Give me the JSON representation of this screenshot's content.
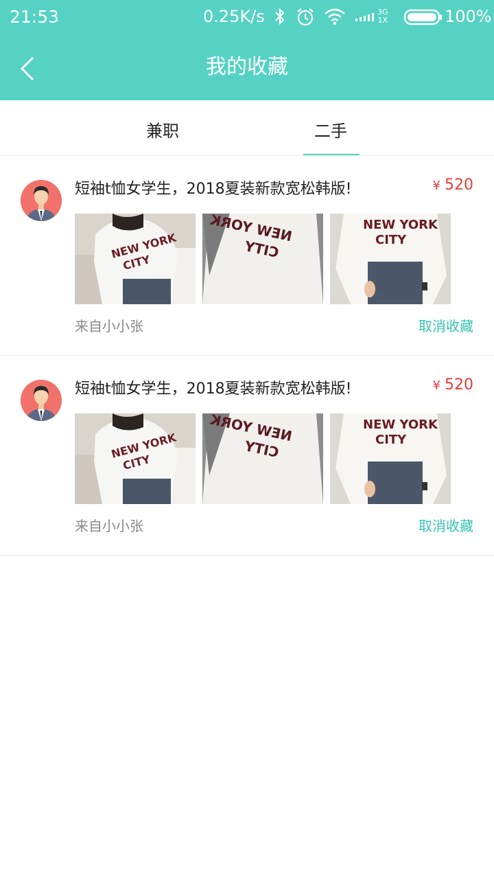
{
  "status_bar": {
    "time": "21:53",
    "speed": "0.25K/s",
    "network_top": "3G",
    "network_bottom": "1X",
    "battery_percent": "100%",
    "icons": [
      "bluetooth-icon",
      "alarm-icon",
      "wifi-icon",
      "signal-icon",
      "battery-icon"
    ]
  },
  "header": {
    "title": "我的收藏",
    "back_icon": "chevron-left-icon",
    "background_color": "#55d2c3"
  },
  "tabs": [
    {
      "label": "兼职",
      "active": false
    },
    {
      "label": "二手",
      "active": true
    }
  ],
  "items": [
    {
      "title": "短袖t恤女学生，2018夏装新款宽松韩版!",
      "currency": "¥",
      "price": "520",
      "from": "来自小小张",
      "cancel_label": "取消收藏",
      "image_text": [
        "NEW YORK",
        "CITY"
      ]
    },
    {
      "title": "短袖t恤女学生，2018夏装新款宽松韩版!",
      "currency": "¥",
      "price": "520",
      "from": "来自小小张",
      "cancel_label": "取消收藏",
      "image_text": [
        "NEW YORK",
        "CITY"
      ]
    }
  ],
  "colors": {
    "accent": "#55d2c3",
    "price": "#ee3b3b",
    "cancel": "#35c3b1"
  }
}
